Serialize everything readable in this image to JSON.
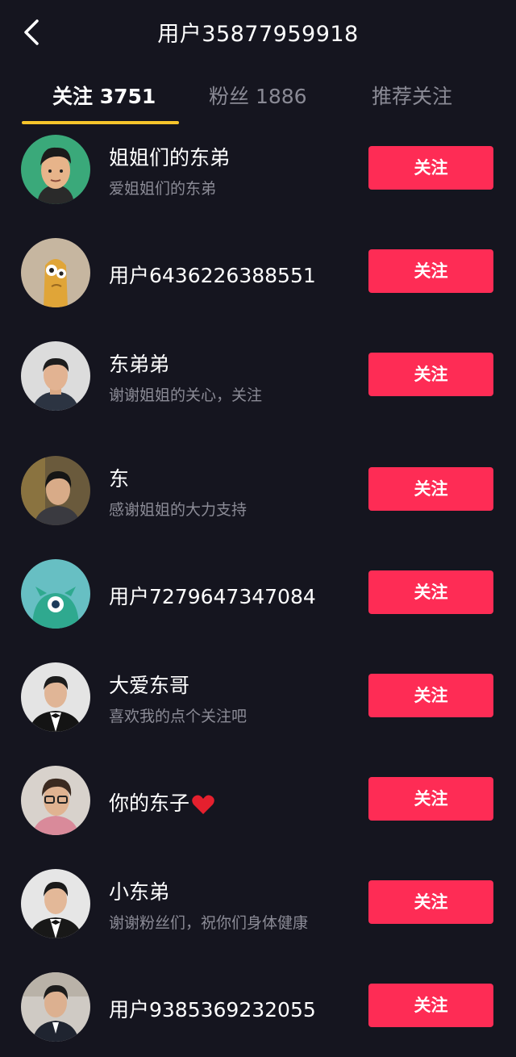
{
  "header": {
    "title": "用户35877959918",
    "back_icon": "chevron-left-icon"
  },
  "tabs": [
    {
      "label": "关注 3751",
      "active": true
    },
    {
      "label": "粉丝 1886",
      "active": false
    },
    {
      "label": "推荐关注",
      "active": false
    }
  ],
  "colors": {
    "background": "#15151f",
    "follow_button": "#fe2c55",
    "tab_indicator": "#f6c42b",
    "secondary_text": "#8b8b96"
  },
  "users": [
    {
      "name": "姐姐们的东弟",
      "desc": "爱姐姐们的东弟",
      "button": "关注",
      "avatar": "cartoon-man-avatar"
    },
    {
      "name": "用户6436226388551",
      "desc": "",
      "button": "关注",
      "avatar": "default-avatar-tan"
    },
    {
      "name": "东弟弟",
      "desc": "谢谢姐姐的关心，关注",
      "button": "关注",
      "avatar": "man-photo-avatar"
    },
    {
      "name": "东",
      "desc": "感谢姐姐的大力支持",
      "button": "关注",
      "avatar": "man-photo-avatar"
    },
    {
      "name": "用户7279647347084",
      "desc": "",
      "button": "关注",
      "avatar": "default-avatar-teal"
    },
    {
      "name": "大爱东哥",
      "desc": "喜欢我的点个关注吧",
      "button": "关注",
      "avatar": "man-tuxedo-avatar"
    },
    {
      "name": "你的东子",
      "desc": "",
      "button": "关注",
      "avatar": "man-glasses-avatar",
      "heart": true
    },
    {
      "name": "小东弟",
      "desc": "谢谢粉丝们，祝你们身体健康",
      "button": "关注",
      "avatar": "man-tuxedo-avatar"
    },
    {
      "name": "用户9385369232055",
      "desc": "",
      "button": "关注",
      "avatar": "man-photo-avatar"
    }
  ]
}
